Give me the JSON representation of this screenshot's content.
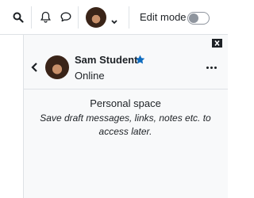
{
  "navbar": {
    "icons": [
      "search-icon",
      "bell-icon",
      "message-icon",
      "chevron-down-icon"
    ],
    "edit_mode_label": "Edit mode",
    "edit_mode_on": false
  },
  "drawer": {
    "close_icon": "close-icon",
    "back_icon": "chevron-left-icon",
    "user": {
      "name": "Sam Student",
      "status": "Online",
      "starred": true
    },
    "more_icon": "ellipsis-icon",
    "personal_space_title": "Personal space",
    "personal_space_description": "Save draft messages, links, notes etc. to access later."
  },
  "colors": {
    "star": "#0f6cbf",
    "text": "#1d2125",
    "border": "#dee2e6",
    "drawer_bg": "#f8f9fa"
  }
}
